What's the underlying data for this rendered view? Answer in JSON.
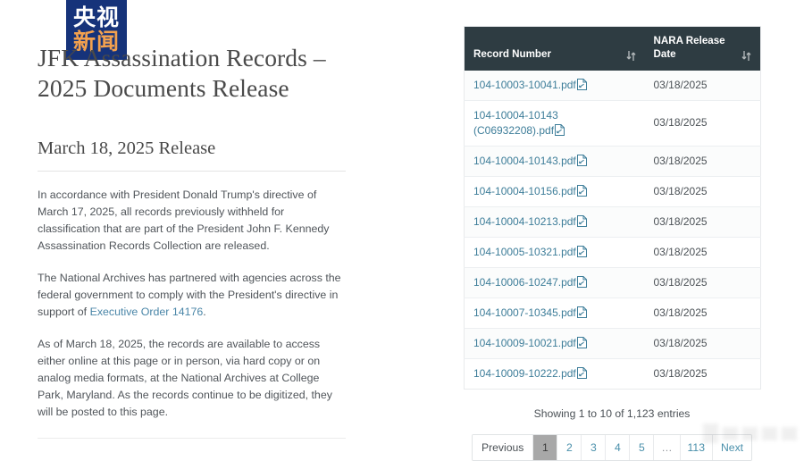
{
  "logo": {
    "top_text": "央视",
    "bottom_text": "新闻",
    "background_color": "#16337a",
    "top_color": "#ffffff",
    "bottom_color": "#f3a14e"
  },
  "article": {
    "title": "JFK Assassination Records – 2025 Documents Release",
    "section_heading": "March 18, 2025 Release",
    "paragraphs": [
      "In accordance with President Donald Trump's directive of March 17, 2025, all records previously withheld for classification that are part of the President John F. Kennedy Assassination Records Collection are released.",
      "As of March 18, 2025, the records are available to access either online at this page or in person, via hard copy or on analog media formats, at the National Archives at College Park, Maryland. As the records continue to be digitized, they will be posted to this page."
    ],
    "paragraph_with_link": {
      "before": "The National Archives has partnered with agencies across the federal government to comply with the President's directive in support of ",
      "link_text": "Executive Order 14176",
      "after": ".",
      "link_color": "#4a86a8"
    }
  },
  "table": {
    "columns": [
      {
        "label": "Record Number",
        "sort_icon": "sort-updown-icon"
      },
      {
        "label": "NARA Release Date",
        "sort_icon": "sort-updown-icon"
      }
    ],
    "header_background": "#2e3c42",
    "link_color": "#3d7d99",
    "rows": [
      {
        "record": "104-10003-10041.pdf",
        "date": "03/18/2025"
      },
      {
        "record": "104-10004-10143 (C06932208).pdf",
        "date": "03/18/2025"
      },
      {
        "record": "104-10004-10143.pdf",
        "date": "03/18/2025"
      },
      {
        "record": "104-10004-10156.pdf",
        "date": "03/18/2025"
      },
      {
        "record": "104-10004-10213.pdf",
        "date": "03/18/2025"
      },
      {
        "record": "104-10005-10321.pdf",
        "date": "03/18/2025"
      },
      {
        "record": "104-10006-10247.pdf",
        "date": "03/18/2025"
      },
      {
        "record": "104-10007-10345.pdf",
        "date": "03/18/2025"
      },
      {
        "record": "104-10009-10021.pdf",
        "date": "03/18/2025"
      },
      {
        "record": "104-10009-10222.pdf",
        "date": "03/18/2025"
      }
    ]
  },
  "footer": {
    "entries_info": "Showing 1 to 10 of 1,123 entries",
    "pagination": {
      "previous_label": "Previous",
      "next_label": "Next",
      "ellipsis": "…",
      "pages": [
        "1",
        "2",
        "3",
        "4",
        "5"
      ],
      "last_page": "113",
      "active_page": "1"
    }
  }
}
